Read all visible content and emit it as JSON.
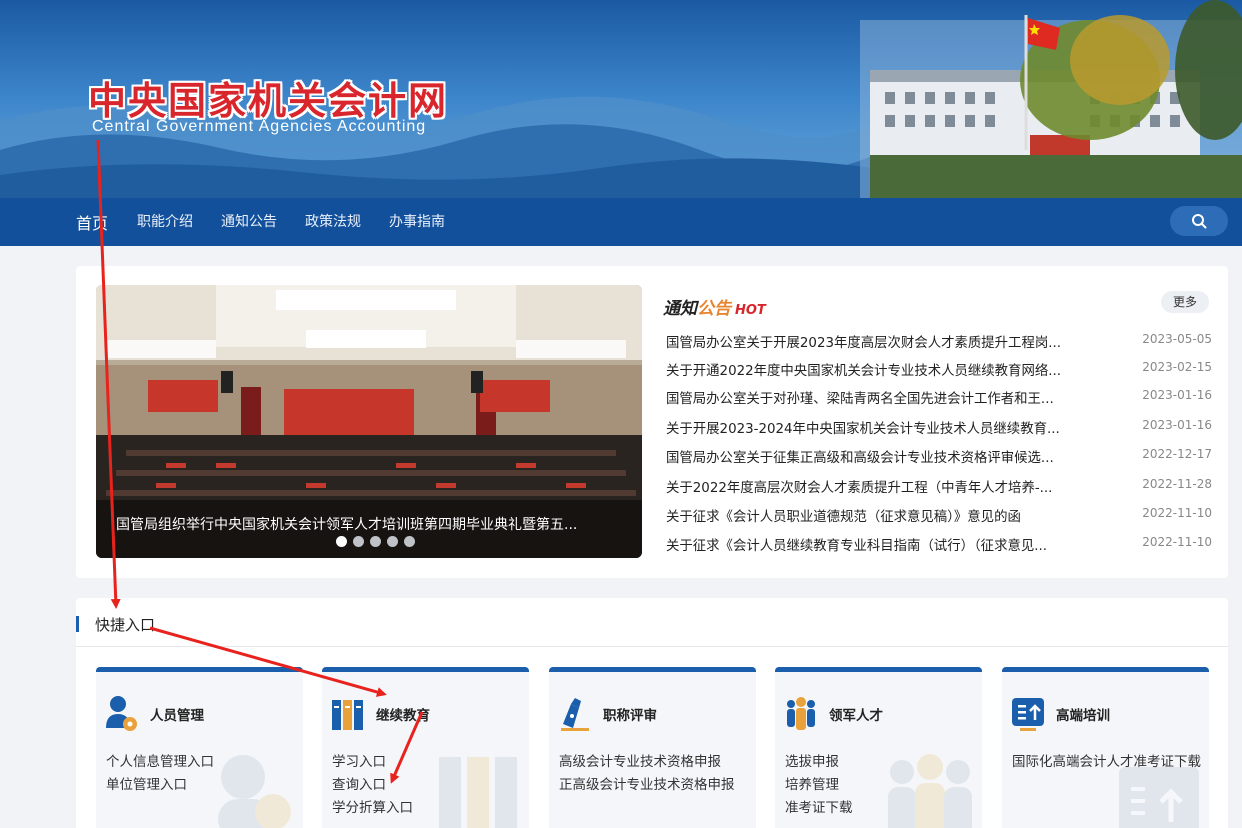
{
  "header": {
    "site_name_cn": "中央国家机关会计网",
    "site_name_en": "Central Government Agencies Accounting"
  },
  "nav": {
    "items": [
      "首页",
      "职能介绍",
      "通知公告",
      "政策法规",
      "办事指南"
    ],
    "search_icon": "search-icon"
  },
  "slider": {
    "caption": "国管局组织举行中央国家机关会计领军人才培训班第四期毕业典礼暨第五...",
    "dot_count": 5,
    "active_dot": 1
  },
  "notices": {
    "title_part1": "通知",
    "title_part2": "公告",
    "hot_label": "HOT",
    "more_label": "更多",
    "items": [
      {
        "title": "国管局办公室关于开展2023年度高层次财会人才素质提升工程岗...",
        "date": "2023-05-05"
      },
      {
        "title": "关于开通2022年度中央国家机关会计专业技术人员继续教育网络...",
        "date": "2023-02-15"
      },
      {
        "title": "国管局办公室关于对孙瑾、梁陆青两名全国先进会计工作者和王...",
        "date": "2023-01-16"
      },
      {
        "title": "关于开展2023-2024年中央国家机关会计专业技术人员继续教育...",
        "date": "2023-01-16"
      },
      {
        "title": "国管局办公室关于征集正高级和高级会计专业技术资格评审候选...",
        "date": "2022-12-17"
      },
      {
        "title": "关于2022年度高层次财会人才素质提升工程（中青年人才培养-...",
        "date": "2022-11-28"
      },
      {
        "title": "关于征求《会计人员职业道德规范（征求意见稿）》意见的函",
        "date": "2022-11-10"
      },
      {
        "title": "关于征求《会计人员继续教育专业科目指南（试行）（征求意见...",
        "date": "2022-11-10"
      }
    ]
  },
  "quick_entry": {
    "title": "快捷入口",
    "cards": [
      {
        "title": "人员管理",
        "icon": "person-gear-icon",
        "links": [
          "个人信息管理入口",
          "单位管理入口"
        ]
      },
      {
        "title": "继续教育",
        "icon": "books-icon",
        "links": [
          "学习入口",
          "查询入口",
          "学分折算入口"
        ]
      },
      {
        "title": "职称评审",
        "icon": "pen-icon",
        "links": [
          "高级会计专业技术资格申报",
          "正高级会计专业技术资格申报"
        ]
      },
      {
        "title": "领军人才",
        "icon": "people-group-icon",
        "links": [
          "选拔申报",
          "培养管理",
          "准考证下载"
        ]
      },
      {
        "title": "高端培训",
        "icon": "list-upload-icon",
        "links": [
          "国际化高端会计人才准考证下载"
        ]
      }
    ]
  },
  "colors": {
    "nav_bg": "#13509b",
    "accent": "#1b5eab",
    "hot_red": "#d8262c",
    "notice_orange": "#e8862f",
    "annotation_arrow": "#e8231d"
  }
}
